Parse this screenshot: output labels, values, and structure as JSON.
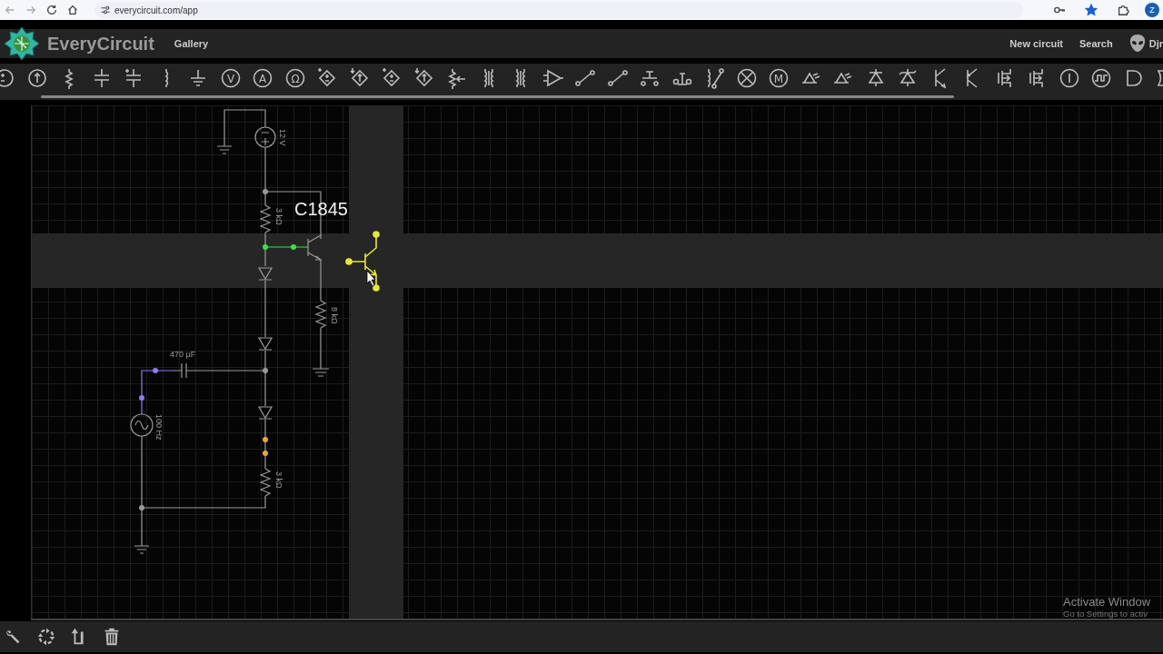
{
  "browser": {
    "url": "everycircuit.com/app",
    "bookmarked": true,
    "profile_initial": "Z"
  },
  "header": {
    "app_name": "EveryCircuit",
    "nav": [
      "Gallery"
    ],
    "actions": [
      "New circuit",
      "Search"
    ],
    "user": "Djr"
  },
  "toolbar": [
    {
      "kind": "battery"
    },
    {
      "kind": "current-source"
    },
    {
      "kind": "resistor"
    },
    {
      "kind": "capacitor"
    },
    {
      "kind": "polar-capacitor"
    },
    {
      "kind": "inductor"
    },
    {
      "kind": "ground"
    },
    {
      "kind": "meter",
      "glyph": "V"
    },
    {
      "kind": "meter",
      "glyph": "A"
    },
    {
      "kind": "meter",
      "glyph": "Ω"
    },
    {
      "kind": "dep-voltage"
    },
    {
      "kind": "dep-current"
    },
    {
      "kind": "dep-voltage"
    },
    {
      "kind": "dep-current"
    },
    {
      "kind": "potentiometer"
    },
    {
      "kind": "transformer"
    },
    {
      "kind": "transformer"
    },
    {
      "kind": "opamp"
    },
    {
      "kind": "switch"
    },
    {
      "kind": "switch"
    },
    {
      "kind": "pushbutton"
    },
    {
      "kind": "pushbutton-closed"
    },
    {
      "kind": "relay"
    },
    {
      "kind": "lamp"
    },
    {
      "kind": "meter",
      "glyph": "M"
    },
    {
      "kind": "led"
    },
    {
      "kind": "led"
    },
    {
      "kind": "diode"
    },
    {
      "kind": "zener"
    },
    {
      "kind": "npn"
    },
    {
      "kind": "pnp"
    },
    {
      "kind": "mosfet"
    },
    {
      "kind": "mosfet"
    },
    {
      "kind": "logic-source"
    },
    {
      "kind": "clock"
    },
    {
      "kind": "and-gate"
    },
    {
      "kind": "or-gate"
    }
  ],
  "circuit": {
    "dc_source": "12 V",
    "resistor_top": "3 kΩ",
    "transistor_label": "C1845",
    "resistor_emitter": "8 kΩ",
    "capacitor": "470 µF",
    "ac_source": "100 Hz",
    "resistor_bottom": "3 kΩ"
  },
  "bottom_tools": [
    {
      "kind": "wrench"
    },
    {
      "kind": "rotate"
    },
    {
      "kind": "flip"
    },
    {
      "kind": "trash"
    }
  ],
  "os_notice": {
    "title": "Activate Window",
    "subtitle": "Go to Settings to activ"
  }
}
